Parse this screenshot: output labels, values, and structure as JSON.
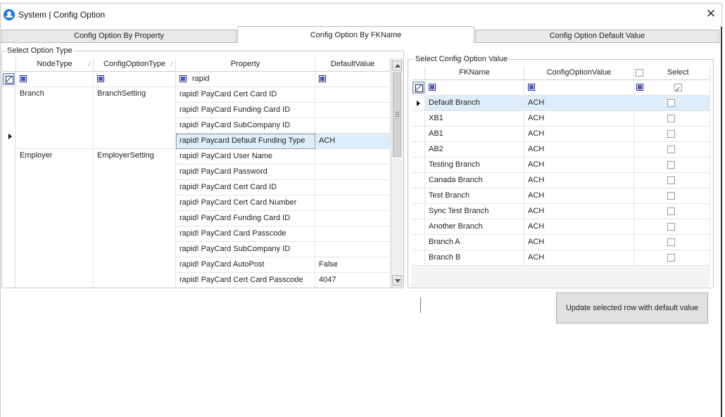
{
  "window": {
    "title": "System | Config Option",
    "close_glyph": "✕"
  },
  "tabs": [
    {
      "label": "Config Option By Property"
    },
    {
      "label": "Config Option By FKName"
    },
    {
      "label": "Config Option Default Value"
    }
  ],
  "left_panel": {
    "title": "Select Option Type",
    "columns": [
      "NodeType",
      "ConfigOptionType",
      "Property",
      "DefaultValue"
    ],
    "filter": {
      "property": "rapid"
    },
    "groups": [
      {
        "node_type": "Branch",
        "config_option_type": "BranchSetting"
      },
      {
        "node_type": "Employer",
        "config_option_type": "EmployerSetting"
      }
    ],
    "rows": [
      {
        "property": "rapid! PayCard Cert Card ID",
        "default_value": ""
      },
      {
        "property": "rapid! PayCard Funding Card ID",
        "default_value": ""
      },
      {
        "property": "rapid! PayCard SubCompany ID",
        "default_value": ""
      },
      {
        "property": "rapid! Paycard Default Funding Type",
        "default_value": "ACH"
      },
      {
        "property": "rapid! PayCard User Name",
        "default_value": ""
      },
      {
        "property": "rapid! PayCard Password",
        "default_value": ""
      },
      {
        "property": "rapid! PayCard Cert Card ID",
        "default_value": ""
      },
      {
        "property": "rapid! PayCard Cert Card Number",
        "default_value": ""
      },
      {
        "property": "rapid! PayCard Funding Card ID",
        "default_value": ""
      },
      {
        "property": "rapid! PayCard Card Passcode",
        "default_value": ""
      },
      {
        "property": "rapid! PayCard SubCompany ID",
        "default_value": ""
      },
      {
        "property": "rapid! PayCard AutoPost",
        "default_value": "False"
      },
      {
        "property": "rapid! PayCard Cert Card Passcode",
        "default_value": "4047"
      }
    ]
  },
  "right_panel": {
    "title": "Select Config Option Value",
    "columns": [
      "FKName",
      "ConfigOptionValue",
      "Select"
    ],
    "rows": [
      {
        "fk_name": "Default Branch",
        "value": "ACH"
      },
      {
        "fk_name": "XB1",
        "value": "ACH"
      },
      {
        "fk_name": "AB1",
        "value": "ACH"
      },
      {
        "fk_name": "AB2",
        "value": "ACH"
      },
      {
        "fk_name": "Testing Branch",
        "value": "ACH"
      },
      {
        "fk_name": "Canada Branch",
        "value": "ACH"
      },
      {
        "fk_name": "Test Branch",
        "value": "ACH"
      },
      {
        "fk_name": "Sync Test Branch",
        "value": "ACH"
      },
      {
        "fk_name": "Another Branch",
        "value": "ACH"
      },
      {
        "fk_name": "Branch A",
        "value": "ACH"
      },
      {
        "fk_name": "Branch B",
        "value": "ACH"
      }
    ]
  },
  "actions": {
    "update_label": "Update selected row with default value"
  },
  "colors": {
    "selected_row": "#ddeefa",
    "selected_border": "#555555"
  }
}
